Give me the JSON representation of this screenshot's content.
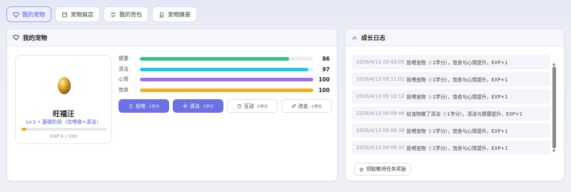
{
  "tabs": [
    {
      "label": "我的宠物",
      "icon": "heart-icon"
    },
    {
      "label": "宠物商店",
      "icon": "shop-icon"
    },
    {
      "label": "我的背包",
      "icon": "swap-icon"
    },
    {
      "label": "宠物换装",
      "icon": "shirt-icon"
    }
  ],
  "pet_panel": {
    "title": "我的宠物",
    "pet": {
      "name": "旺福汪",
      "level": "Lv.1 • 基础阶段（仅喂食+清洁）",
      "exp_text": "EXP 6 / 100",
      "exp_fraction": 0.06
    },
    "stats": [
      {
        "label": "健康",
        "value": "86",
        "fraction": 0.86,
        "color": "#2cc486"
      },
      {
        "label": "清洁",
        "value": "97",
        "fraction": 0.97,
        "color": "#1ec7df"
      },
      {
        "label": "心情",
        "value": "100",
        "fraction": 1.0,
        "color": "#9b6cf0"
      },
      {
        "label": "饱食",
        "value": "100",
        "fraction": 1.0,
        "color": "#f0b21a"
      }
    ],
    "actions": [
      {
        "label": "投喂",
        "cost": "-1学分",
        "icon": "drop-icon"
      },
      {
        "label": "清洁",
        "cost": "-1学分",
        "icon": "sparkle-icon"
      },
      {
        "label": "互动",
        "cost": "-1学分",
        "icon": "hand-icon"
      },
      {
        "label": "改名",
        "cost": "-1学分",
        "icon": "pencil-icon"
      }
    ]
  },
  "log_panel": {
    "title": "成长日志",
    "entries": [
      {
        "time": "2026/4/13 20:43:05",
        "text": "投喂宠物（-1学分），饱食与心情提升，EXP+1"
      },
      {
        "time": "2026/4/13 09:11:01",
        "text": "投喂宠物（-1学分），饱食与心情提升，EXP+1"
      },
      {
        "time": "2026/4/13 09:10:12",
        "text": "投喂宠物（-1学分），饱食与心情提升，EXP+1"
      },
      {
        "time": "2026/4/13 09:09:46",
        "text": "给宠物做了清洁（-1学分），清洁与健康提升，EXP+1"
      },
      {
        "time": "2026/4/13 09:09:38",
        "text": "投喂宠物（-1学分），饱食与心情提升，EXP+1"
      },
      {
        "time": "2026/4/13 09:09:37",
        "text": "投喂宠物（-1学分），饱食与心情提升，EXP+1"
      }
    ],
    "claim_label": "领取教师任务奖励"
  },
  "colors": {
    "accent": "#6c72e6",
    "exp": "#f2a900"
  }
}
